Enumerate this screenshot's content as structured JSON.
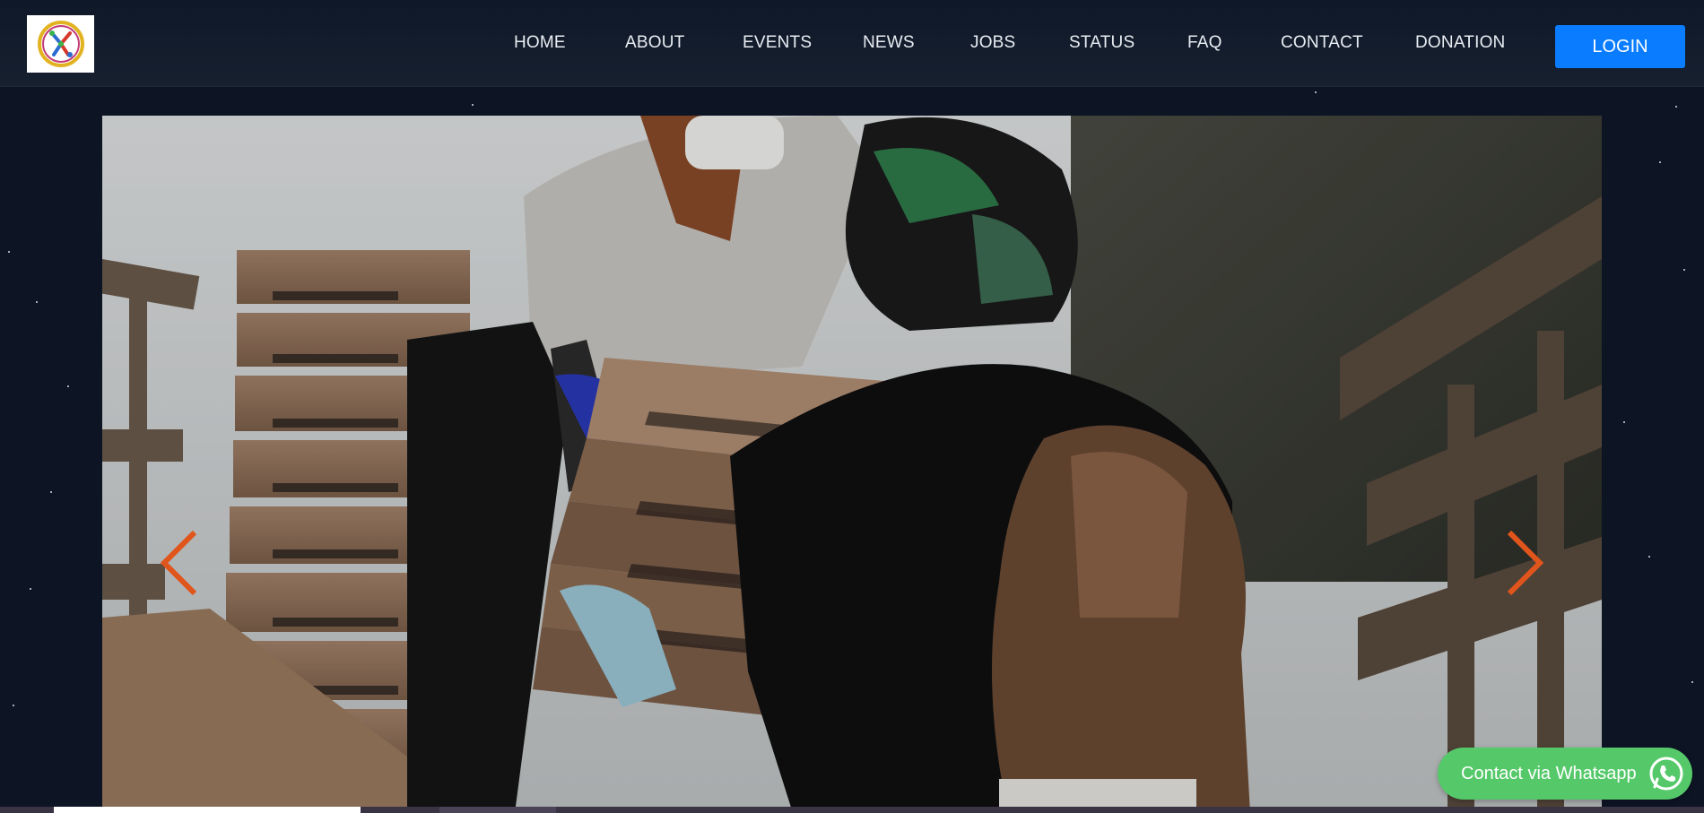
{
  "nav": {
    "items": [
      {
        "label": "HOME"
      },
      {
        "label": "ABOUT"
      },
      {
        "label": "EVENTS"
      },
      {
        "label": "NEWS"
      },
      {
        "label": "JOBS"
      },
      {
        "label": "STATUS"
      },
      {
        "label": "FAQ"
      },
      {
        "label": "CONTACT"
      },
      {
        "label": "DONATION"
      }
    ],
    "login_label": "LOGIN"
  },
  "hero": {
    "prev_icon": "chevron-left-icon",
    "next_icon": "chevron-right-icon",
    "slide_progress": 0.18
  },
  "whatsapp": {
    "label": "Contact via Whatsapp",
    "icon": "whatsapp-icon"
  },
  "colors": {
    "accent": "#0a7cff",
    "arrow": "#e0551c",
    "whatsapp": "#55c96a",
    "background": "#0d1424"
  }
}
